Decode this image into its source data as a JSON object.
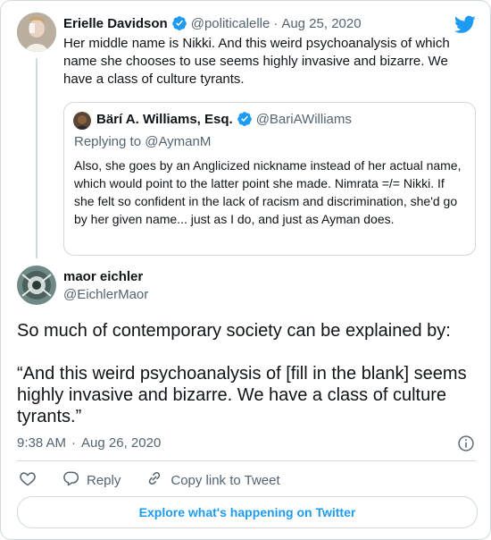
{
  "parent_tweet": {
    "author_name": "Erielle Davidson",
    "handle": "@politicalelle",
    "separator": "·",
    "date": "Aug 25, 2020",
    "text": "Her middle name is Nikki. And this weird psychoanalysis of which name she chooses to use seems highly invasive and bizarre. We have a class of culture tyrants."
  },
  "quoted_tweet": {
    "author_name": "Bärí A. Williams, Esq.",
    "handle": "@BariAWilliams",
    "replying_to": "Replying to @AymanM",
    "text": "Also, she goes by an Anglicized nickname instead of her actual name, which would point to the latter point she made. Nimrata =/= Nikki. If she felt so confident in the lack of racism and discrimination, she'd go by her given name... just as I do, and just as Ayman does."
  },
  "main_tweet": {
    "author_name": "maor eichler",
    "handle": "@EichlerMaor",
    "paragraph1": "So much of contemporary society can be explained by:",
    "paragraph2": "“And this weird psychoanalysis of [fill in the blank] seems highly invasive and bizarre. We have a class of culture tyrants.”",
    "time": "9:38 AM",
    "separator": "·",
    "date": "Aug 26, 2020"
  },
  "actions": {
    "reply_label": "Reply",
    "copy_link_label": "Copy link to Tweet"
  },
  "explore_label": "Explore what's happening on Twitter",
  "colors": {
    "twitter_blue": "#1d9bf0",
    "verified": "#1d9bf0",
    "muted_text": "#536471",
    "border": "#cfd9de"
  },
  "icons": [
    "twitter-logo-icon",
    "verified-badge-icon",
    "info-icon",
    "heart-icon",
    "reply-icon",
    "link-icon"
  ]
}
